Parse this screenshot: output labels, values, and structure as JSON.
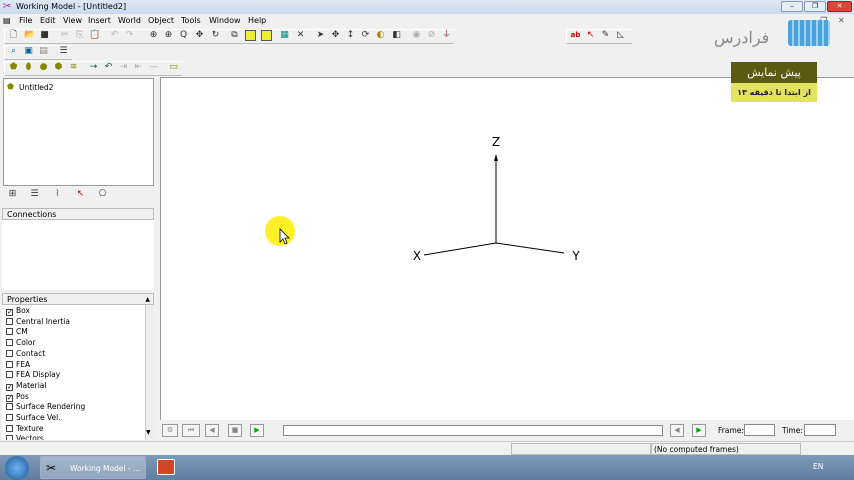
{
  "window": {
    "title": "Working Model - [Untitled2]"
  },
  "menu": [
    "File",
    "Edit",
    "View",
    "Insert",
    "World",
    "Object",
    "Tools",
    "Window",
    "Help"
  ],
  "tree": {
    "root": "Untitled2"
  },
  "connections": {
    "header": "Connections"
  },
  "properties": {
    "header": "Properties",
    "items": [
      {
        "label": "Box",
        "checked": true
      },
      {
        "label": "Central Inertia",
        "checked": false
      },
      {
        "label": "CM",
        "checked": false
      },
      {
        "label": "Color",
        "checked": false
      },
      {
        "label": "Contact",
        "checked": false
      },
      {
        "label": "FEA",
        "checked": false
      },
      {
        "label": "FEA Display",
        "checked": false
      },
      {
        "label": "Material",
        "checked": true
      },
      {
        "label": "Pos",
        "checked": true
      },
      {
        "label": "Surface Rendering",
        "checked": false
      },
      {
        "label": "Surface Vel.",
        "checked": false
      },
      {
        "label": "Texture",
        "checked": false
      },
      {
        "label": "Vectors",
        "checked": false
      }
    ]
  },
  "axes": {
    "z": "Z",
    "x": "X",
    "y": "Y"
  },
  "playback": {
    "frame_label": "Frame:",
    "time_label": "Time:",
    "frame_value": "",
    "time_value": ""
  },
  "status": {
    "frames": "(No computed frames)"
  },
  "watermark": {
    "brand": "فرادرس",
    "banner_title": "پیش نمایش",
    "banner_sub": "از ابتدا تا دقیقه ۱۳"
  },
  "taskbar": {
    "app": "Working Model - ...",
    "lang": "EN"
  }
}
